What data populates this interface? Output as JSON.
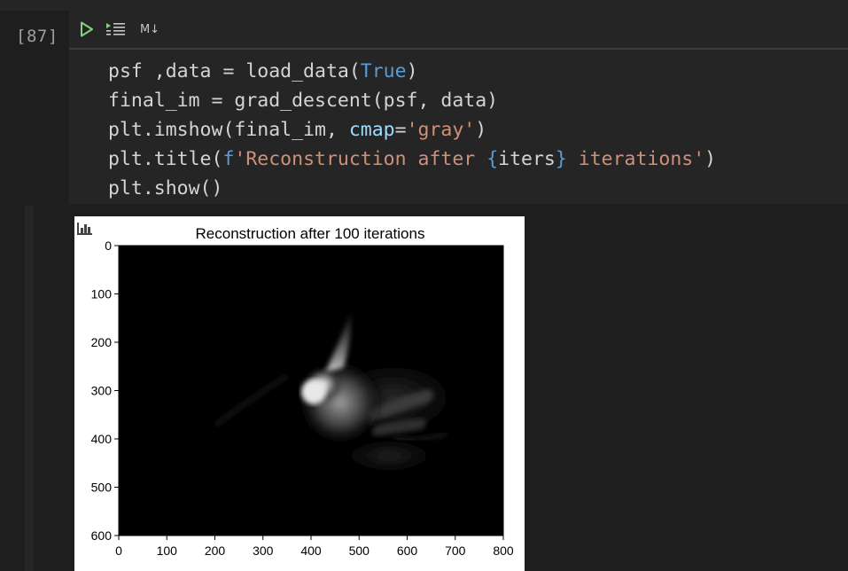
{
  "cell": {
    "execution_count": "[87]",
    "toolbar": {
      "run_icon": "play-icon",
      "run_below_icon": "run-below-icon",
      "markdown_label": "M↓"
    },
    "code_lines": [
      "psf ,data = load_data(True)",
      "final_im = grad_descent(psf, data)",
      "plt.imshow(final_im, cmap='gray')",
      "plt.title(f'Reconstruction after {iters} iterations')",
      "plt.show()"
    ]
  },
  "output": {
    "plot_toolbar_icon": "bar-chart-icon",
    "chart_data": {
      "type": "heatmap",
      "title": "Reconstruction after 100 iterations",
      "colormap": "gray",
      "x_ticks": [
        "0",
        "100",
        "200",
        "300",
        "400",
        "500",
        "600",
        "700",
        "800"
      ],
      "y_ticks": [
        "0",
        "100",
        "200",
        "300",
        "400",
        "500",
        "600"
      ],
      "xlim": [
        0,
        800
      ],
      "ylim": [
        600,
        0
      ]
    }
  }
}
